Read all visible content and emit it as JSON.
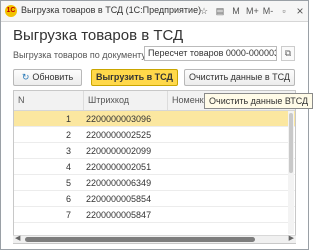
{
  "window": {
    "title": "Выгрузка товаров в ТСД  (1С:Предприятие)",
    "icons": [
      "star-icon",
      "bookmark-icon",
      "M",
      "M+",
      "M-",
      "restore-icon",
      "close-icon"
    ],
    "icon_glyphs": [
      "☆",
      "▤",
      "M",
      "M+",
      "M-",
      "▫",
      "×"
    ]
  },
  "heading": "Выгрузка товаров в ТСД",
  "document_field": {
    "label": "Выгрузка товаров по документу :",
    "value": "Пересчет товаров 0000-000003",
    "open_glyph": "⧉"
  },
  "toolbar": {
    "refresh_label": "Обновить",
    "refresh_glyph": "↻",
    "export_label": "Выгрузить в ТСД",
    "clear_label": "Очистить данные в ТСД"
  },
  "tooltip": "Очистить данные ВТСД",
  "table": {
    "columns": [
      "N",
      "Штрихкод",
      "Номенклатура"
    ],
    "rows": [
      {
        "n": "1",
        "barcode": "2200000003096",
        "selected": true
      },
      {
        "n": "2",
        "barcode": "2200000002525",
        "selected": false
      },
      {
        "n": "3",
        "barcode": "2200000002099",
        "selected": false
      },
      {
        "n": "4",
        "barcode": "2200000002051",
        "selected": false
      },
      {
        "n": "5",
        "barcode": "2200000006349",
        "selected": false
      },
      {
        "n": "6",
        "barcode": "2200000005854",
        "selected": false
      },
      {
        "n": "7",
        "barcode": "2200000005847",
        "selected": false
      }
    ]
  },
  "colors": {
    "accent_button": "#ffd84a",
    "selected_row": "#fbe7a0"
  }
}
